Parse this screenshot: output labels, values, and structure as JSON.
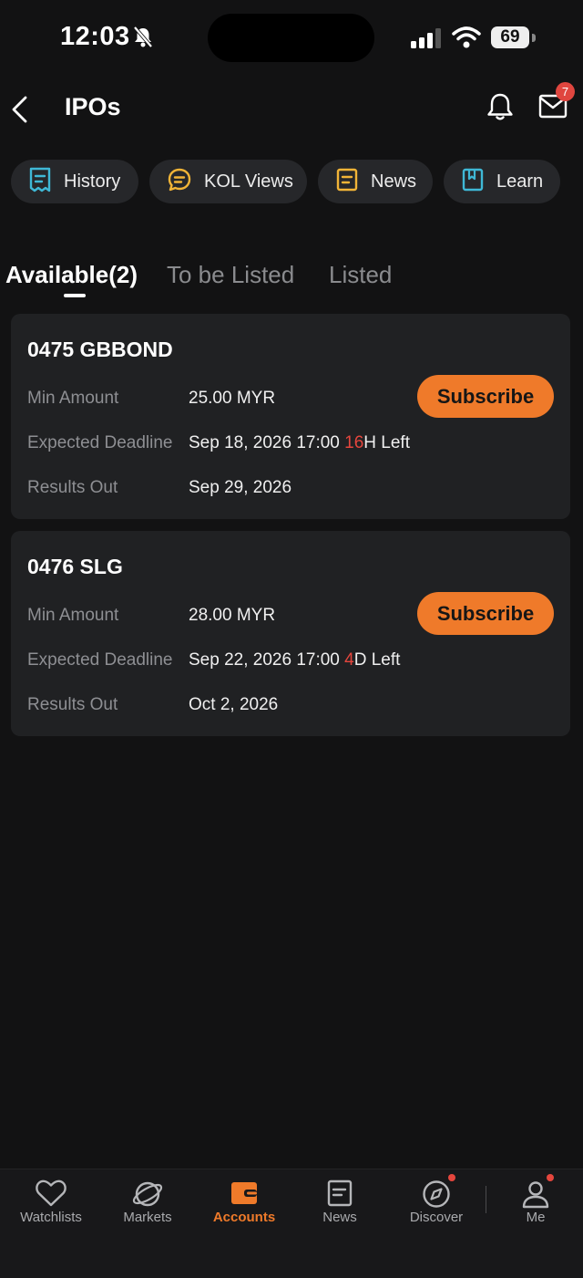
{
  "status": {
    "time": "12:03",
    "battery": "69"
  },
  "header": {
    "title": "IPOs",
    "mail_badge": "7"
  },
  "chips": [
    {
      "label": "History",
      "icon": "receipt-icon",
      "color": "#3fb8d6"
    },
    {
      "label": "KOL Views",
      "icon": "chat-icon",
      "color": "#f2b437"
    },
    {
      "label": "News",
      "icon": "document-icon",
      "color": "#f2b437"
    },
    {
      "label": "Learn",
      "icon": "bookmark-icon",
      "color": "#3fb8d6"
    }
  ],
  "tabs": [
    {
      "label": "Available(2)",
      "active": true
    },
    {
      "label": "To be Listed"
    },
    {
      "label": "Listed"
    }
  ],
  "ipos": [
    {
      "name": "0475 GBBOND",
      "min_amount_label": "Min Amount",
      "min_amount": "25.00 MYR",
      "deadline_label": "Expected Deadline",
      "deadline": "Sep 18, 2026 17:00",
      "left_num": "16",
      "left_suffix": "H Left",
      "results_label": "Results Out",
      "results": "Sep 29, 2026",
      "button": "Subscribe"
    },
    {
      "name": "0476 SLG",
      "min_amount_label": "Min Amount",
      "min_amount": "28.00 MYR",
      "deadline_label": "Expected Deadline",
      "deadline": "Sep 22, 2026 17:00",
      "left_num": "4",
      "left_suffix": "D Left",
      "results_label": "Results Out",
      "results": "Oct 2, 2026",
      "button": "Subscribe"
    }
  ],
  "tabbar": [
    {
      "label": "Watchlists",
      "icon": "heart-icon"
    },
    {
      "label": "Markets",
      "icon": "planet-icon"
    },
    {
      "label": "Accounts",
      "icon": "wallet-icon",
      "active": true
    },
    {
      "label": "News",
      "icon": "news-icon"
    },
    {
      "label": "Discover",
      "icon": "compass-icon"
    },
    {
      "label": "Me",
      "icon": "user-icon"
    }
  ],
  "colors": {
    "accent": "#ef7a2a",
    "alert": "#e5463d",
    "background": "#121213",
    "card": "#202123"
  }
}
